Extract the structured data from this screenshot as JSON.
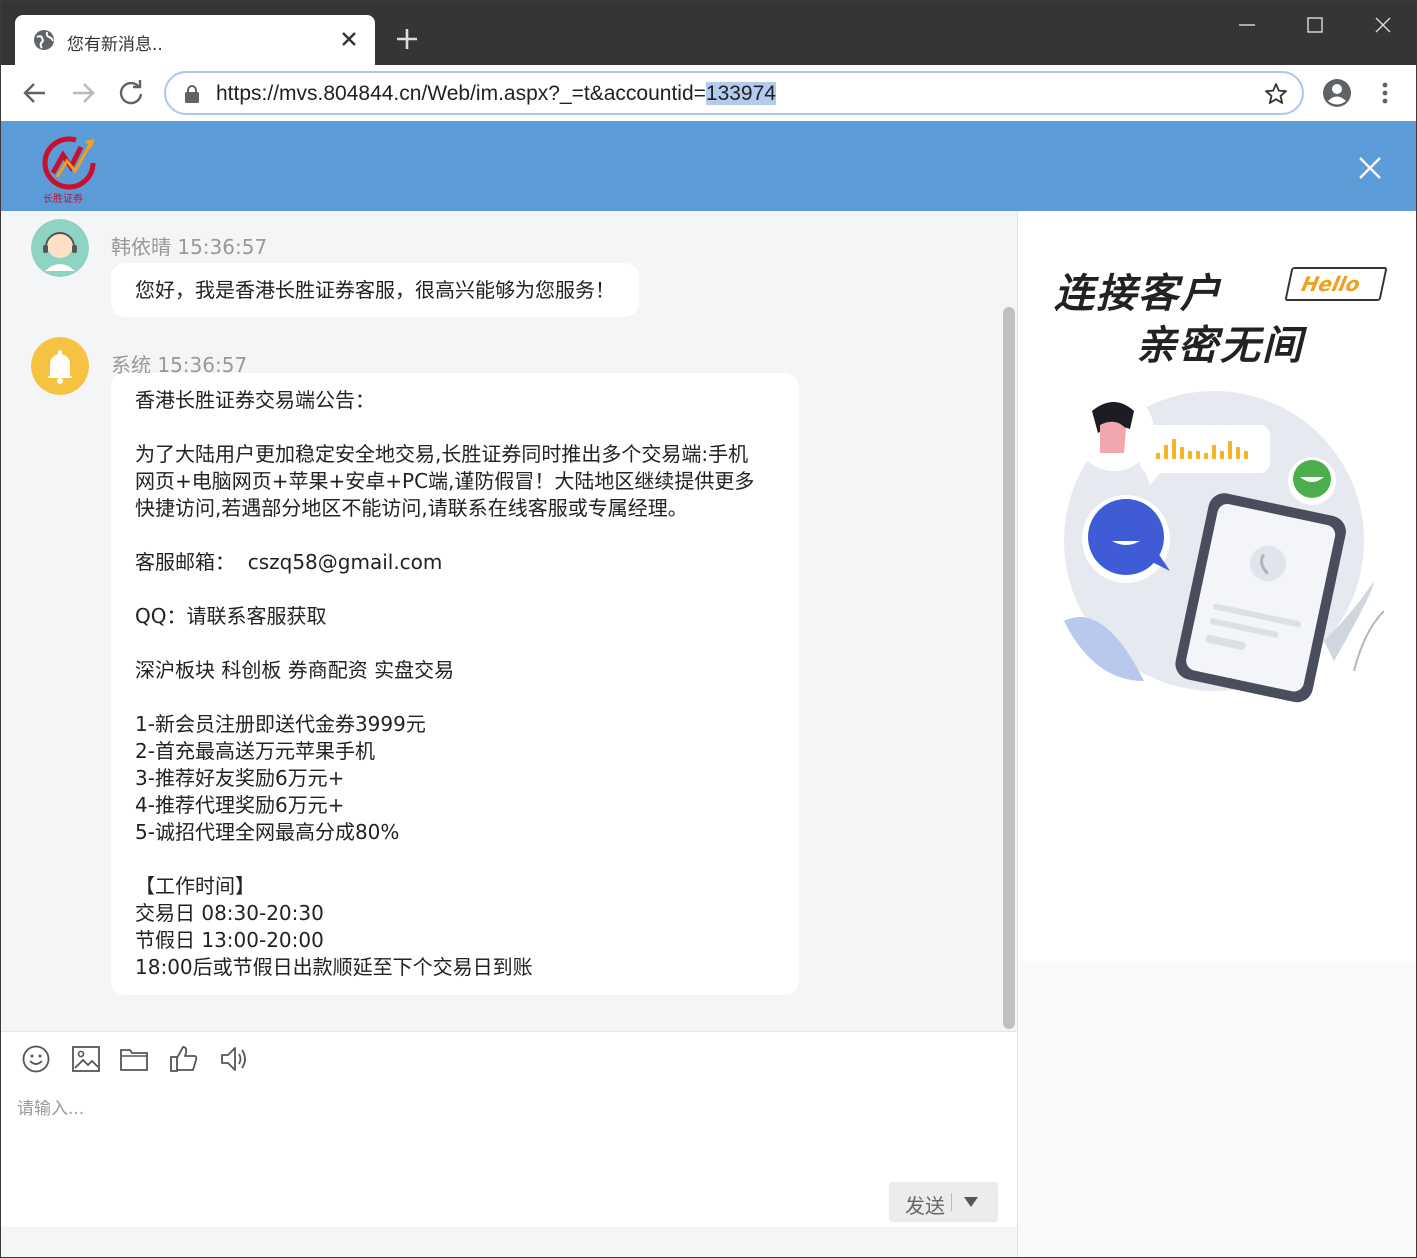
{
  "browser": {
    "tab_title": "您有新消息..",
    "url_prefix": "https://mvs.804844.cn/Web/im.aspx?_=t&accountid=",
    "url_selected": "133974"
  },
  "header": {
    "logo_text": "长胜证券"
  },
  "messages": [
    {
      "sender": "韩依晴 15:36:57",
      "lines": [
        "您好，我是香港长胜证券客服，很高兴能够为您服务！"
      ]
    },
    {
      "sender": "系统 15:36:57",
      "lines": [
        "香港长胜证券交易端公告：",
        "",
        "为了大陆用户更加稳定安全地交易,长胜证券同时推出多个交易端:手机",
        "网页+电脑网页+苹果+安卓+PC端,谨防假冒！大陆地区继续提供更多",
        "快捷访问,若遇部分地区不能访问,请联系在线客服或专属经理。",
        "",
        "客服邮箱：  cszq58@gmail.com",
        "",
        "QQ：请联系客服获取",
        "",
        "深沪板块 科创板 券商配资 实盘交易",
        "",
        "1-新会员注册即送代金券3999元",
        "2-首充最高送万元苹果手机",
        "3-推荐好友奖励6万元+",
        "4-推荐代理奖励6万元+",
        "5-诚招代理全网最高分成80%",
        "",
        "【工作时间】",
        "交易日 08:30-20:30",
        "节假日 13:00-20:00",
        "18:00后或节假日出款顺延至下个交易日到账"
      ]
    }
  ],
  "composer": {
    "placeholder": "请输入...",
    "send_label": "发送"
  },
  "side": {
    "slogan_line1": "连接客户",
    "slogan_line2": "亲密无间",
    "hello_badge": "Hello"
  },
  "colors": {
    "header_blue": "#5b9bd8",
    "chat_bg": "#f4f5f7",
    "accent_yellow": "#f5c242",
    "accent_blue": "#3f5bd6",
    "accent_green": "#4cae4c"
  }
}
